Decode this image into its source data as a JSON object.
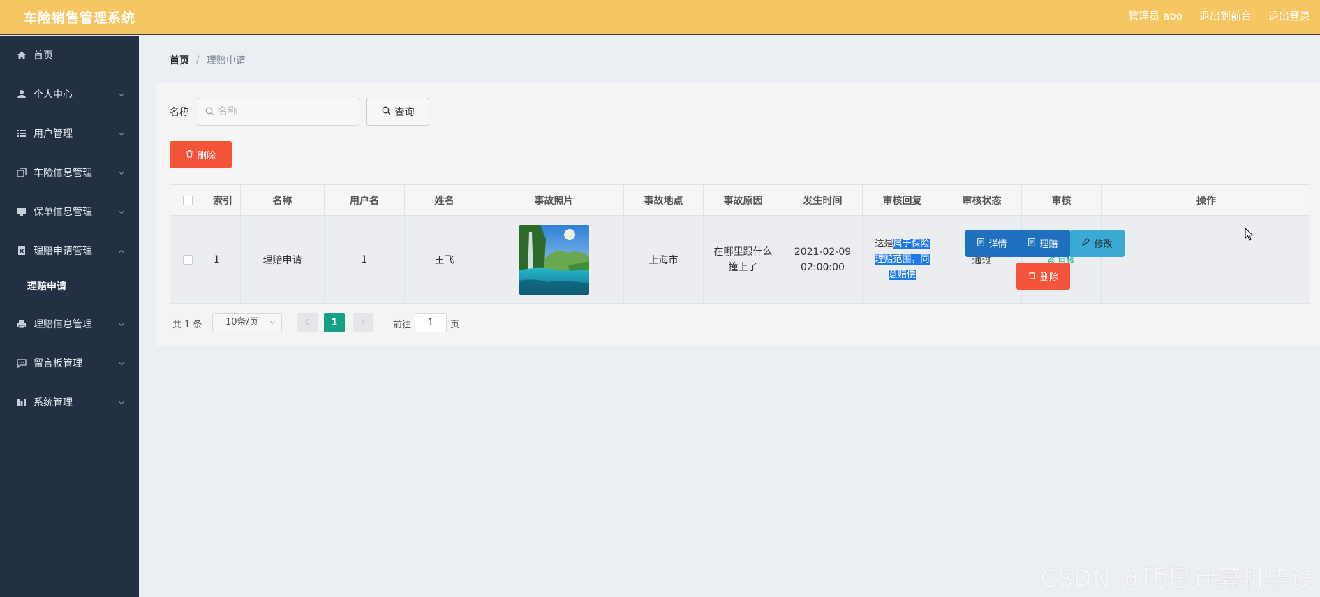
{
  "header": {
    "app_title": "车险销售管理系统",
    "user_label": "管理员 abo",
    "to_front_label": "退出到前台",
    "logout_label": "退出登录"
  },
  "sidebar": {
    "items": [
      {
        "label": "首页",
        "icon": "home-icon"
      },
      {
        "label": "个人中心",
        "icon": "user-icon"
      },
      {
        "label": "用户管理",
        "icon": "list-icon"
      },
      {
        "label": "车险信息管理",
        "icon": "copy-icon"
      },
      {
        "label": "保单信息管理",
        "icon": "monitor-icon"
      },
      {
        "label": "理赔申请管理",
        "icon": "document-x-icon",
        "expanded": true
      },
      {
        "label": "理赔信息管理",
        "icon": "printer-icon"
      },
      {
        "label": "留言板管理",
        "icon": "chat-icon"
      },
      {
        "label": "系统管理",
        "icon": "chart-bar-icon"
      }
    ],
    "subitem": "理赔申请"
  },
  "breadcrumb": {
    "home": "首页",
    "separator": "/",
    "current": "理赔申请"
  },
  "search": {
    "label": "名称",
    "placeholder": "名称",
    "value": "",
    "query_label": "查询"
  },
  "toolbar": {
    "delete_label": "删除"
  },
  "table": {
    "columns": [
      "索引",
      "名称",
      "用户名",
      "姓名",
      "事故照片",
      "事故地点",
      "事故原因",
      "发生时间",
      "审核回复",
      "审核状态",
      "审核",
      "操作"
    ],
    "rows": [
      {
        "index": "1",
        "name": "理赔申请",
        "username": "1",
        "real_name": "王飞",
        "location": "上海市",
        "reason": "在哪里跟什么撞上了",
        "time": "2021-02-09 02:00:00",
        "reply_plain": "这是",
        "reply_highlight": "属于保险理赔范围，同意赔偿",
        "status": "通过",
        "audit_label": "审核",
        "actions": {
          "detail": "详情",
          "claim": "理赔",
          "edit": "修改",
          "delete": "删除"
        }
      }
    ]
  },
  "pagination": {
    "total_text": "共 1 条",
    "page_size": "10条/页",
    "current_page": "1",
    "goto_prefix": "前往",
    "goto_value": "1",
    "goto_suffix": "页"
  },
  "watermark": "CSDN @明思计算机毕设",
  "colors": {
    "header_bg": "#f5c662",
    "sidebar_bg": "#233044",
    "danger": "#f4553a",
    "primary": "#1e6fbd",
    "info": "#3aa9d4",
    "success": "#16a085",
    "highlight": "#1f7ae8"
  }
}
